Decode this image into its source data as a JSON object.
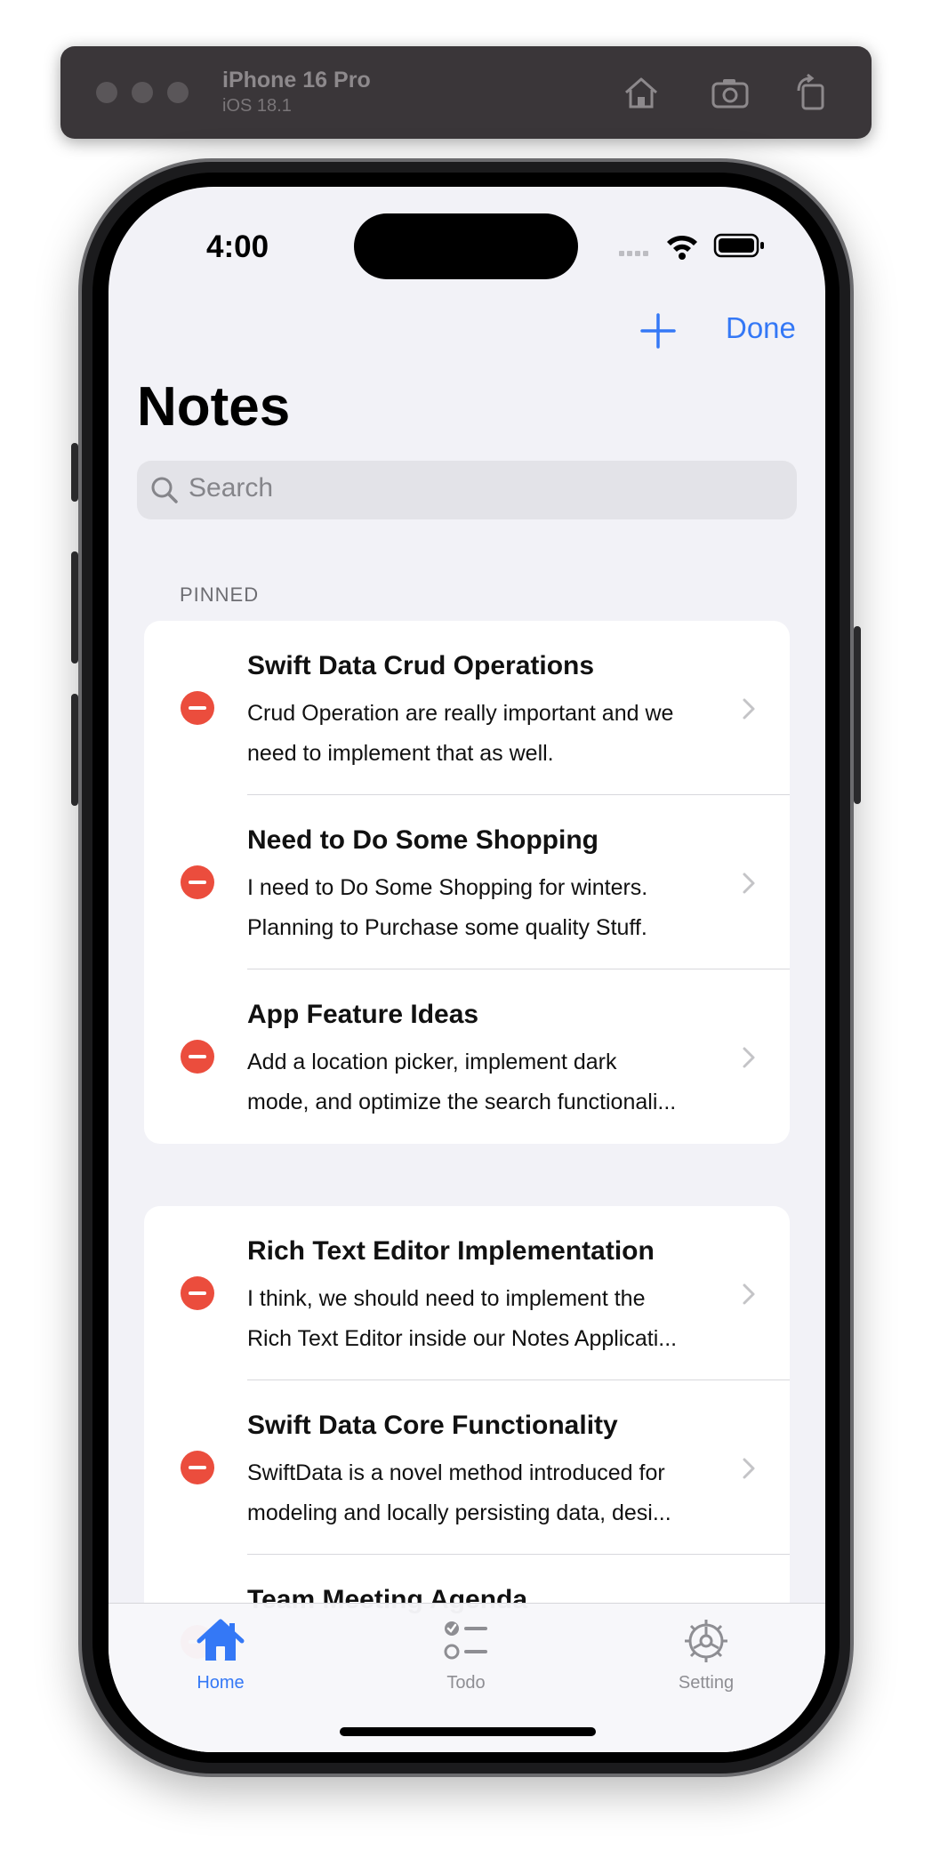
{
  "simulator": {
    "device_name": "iPhone 16 Pro",
    "os_version": "iOS 18.1"
  },
  "status_bar": {
    "time": "4:00"
  },
  "nav": {
    "done_label": "Done",
    "large_title": "Notes"
  },
  "search": {
    "placeholder": "Search"
  },
  "sections": {
    "pinned_header": "PINNED"
  },
  "pinned_notes": [
    {
      "title": "Swift Data Crud Operations",
      "line1": "Crud Operation are really important and we",
      "line2": "need to implement that as well."
    },
    {
      "title": "Need to Do Some Shopping",
      "line1": "I need to Do Some Shopping for winters.",
      "line2": "Planning to Purchase some quality Stuff."
    },
    {
      "title": "App Feature Ideas",
      "line1": "Add a location picker, implement dark",
      "line2": "mode, and optimize the search functionali..."
    }
  ],
  "other_notes": [
    {
      "title": "Rich Text Editor Implementation",
      "line1": "I think, we should need to implement the",
      "line2": "Rich Text Editor inside our Notes Applicati..."
    },
    {
      "title": "Swift Data Core Functionality",
      "line1": "SwiftData is a novel method introduced for",
      "line2": "modeling and locally persisting data, desi..."
    },
    {
      "title": "Team Meeting Agenda",
      "line1": "",
      "line2": ""
    }
  ],
  "tabs": [
    {
      "label": "Home",
      "icon": "house-icon",
      "selected": true
    },
    {
      "label": "Todo",
      "icon": "checklist-icon",
      "selected": false
    },
    {
      "label": "Setting",
      "icon": "gear-icon",
      "selected": false
    }
  ],
  "colors": {
    "accent": "#3478f6",
    "delete": "#eb4d3d",
    "tab_inactive": "#8e8e93",
    "background": "#f2f2f7"
  }
}
